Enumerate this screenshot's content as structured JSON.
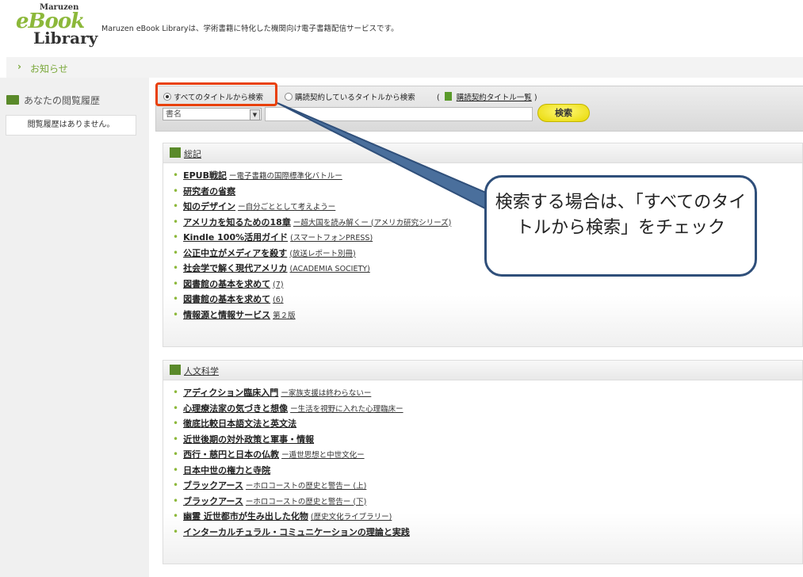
{
  "header": {
    "logo_maruzen": "Maruzen",
    "logo_ebook": "eBook",
    "logo_library": "Library",
    "tagline": "Maruzen eBook Libraryは、学術書籍に特化した機関向け電子書籍配信サービスです。"
  },
  "notice": {
    "label": "お知らせ"
  },
  "sidebar": {
    "history_title": "あなたの閲覧履歴",
    "history_empty": "閲覧履歴はありません。"
  },
  "search": {
    "option_all": "すべてのタイトルから検索",
    "option_subscribed": "購読契約しているタイトルから検索",
    "open_paren": "(",
    "subscribed_list_link": "購読契約タイトル一覧",
    "close_paren": ")",
    "field_select": "書名",
    "button": "検索"
  },
  "categories": [
    {
      "name": "総記",
      "items": [
        {
          "title": "EPUB戦記",
          "sub": "ー電子書籍の国際標準化バトルー"
        },
        {
          "title": "研究者の省察",
          "sub": ""
        },
        {
          "title": "知のデザイン",
          "sub": "ー自分ごととして考えようー"
        },
        {
          "title": "アメリカを知るための18章",
          "sub": "ー超大国を読み解くー (アメリカ研究シリーズ)"
        },
        {
          "title": "Kindle 100%活用ガイド",
          "sub": "(スマートフォンPRESS)"
        },
        {
          "title": "公正中立がメディアを殺す",
          "sub": "(放送レポート別冊)"
        },
        {
          "title": "社会学で解く現代アメリカ",
          "sub": "(ACADEMIA SOCIETY)"
        },
        {
          "title": "図書館の基本を求めて",
          "sub": "(7)"
        },
        {
          "title": "図書館の基本を求めて",
          "sub": "(6)"
        },
        {
          "title": "情報源と情報サービス",
          "sub": "第２版"
        }
      ]
    },
    {
      "name": "人文科学",
      "items": [
        {
          "title": "アディクション臨床入門",
          "sub": "ー家族支援は終わらないー"
        },
        {
          "title": "心理療法家の気づきと想像",
          "sub": "ー生活を視野に入れた心理臨床ー"
        },
        {
          "title": "徹底比較日本語文法と英文法",
          "sub": ""
        },
        {
          "title": "近世後期の対外政策と軍事・情報",
          "sub": ""
        },
        {
          "title": "西行・慈円と日本の仏教",
          "sub": "ー遁世思想と中世文化ー"
        },
        {
          "title": "日本中世の権力と寺院",
          "sub": ""
        },
        {
          "title": "ブラックアース",
          "sub": "ーホロコーストの歴史と警告ー (上)"
        },
        {
          "title": "ブラックアース",
          "sub": "ーホロコーストの歴史と警告ー (下)"
        },
        {
          "title": "幽霊 近世都市が生み出した化物",
          "sub": "(歴史文化ライブラリー)"
        },
        {
          "title": "インターカルチュラル・コミュニケーションの理論と実践",
          "sub": ""
        }
      ]
    }
  ],
  "callout": {
    "text": "検索する場合は、「すべてのタイトルから検索」をチェック"
  },
  "colors": {
    "brand_green": "#8cb83a",
    "highlight_red": "#e8400a",
    "callout_border": "#2f4f7a",
    "search_button": "#f5ea2a"
  }
}
